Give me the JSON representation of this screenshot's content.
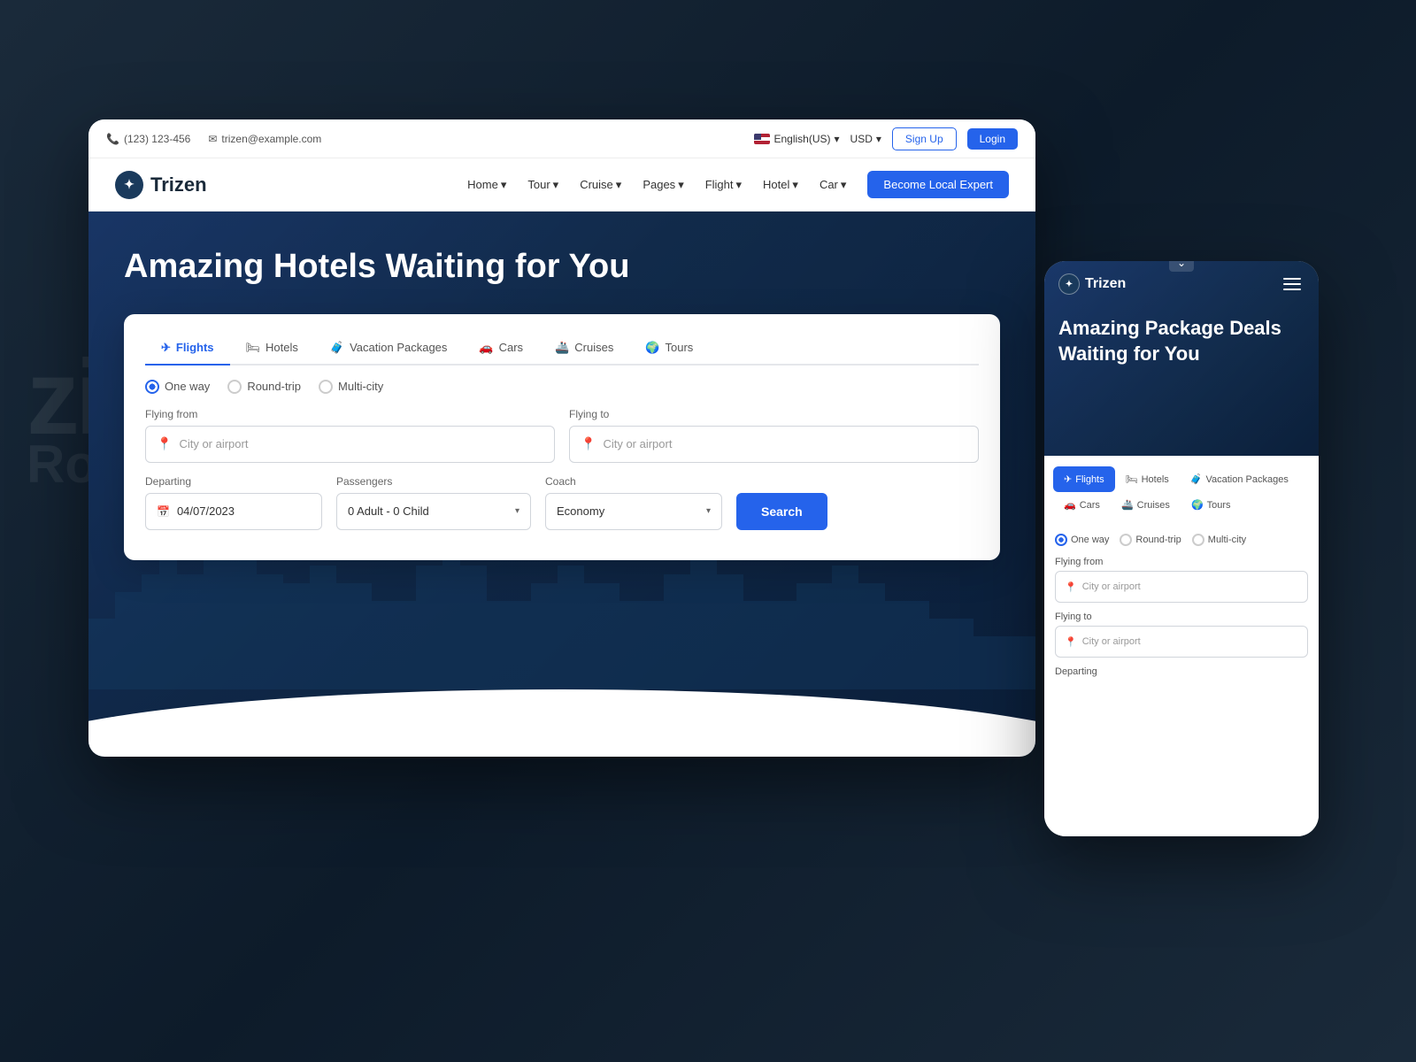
{
  "background": {
    "color": "#1a2a3a"
  },
  "topbar": {
    "phone": "(123) 123-456",
    "email": "trizen@example.com",
    "language": "English(US)",
    "currency": "USD",
    "signup_label": "Sign Up",
    "login_label": "Login"
  },
  "navbar": {
    "logo_text": "Trizen",
    "nav_items": [
      "Home",
      "Tour",
      "Cruise",
      "Pages",
      "Flight",
      "Hotel",
      "Car"
    ],
    "cta_label": "Become Local Expert"
  },
  "hero": {
    "title": "Amazing Hotels Waiting for You"
  },
  "search": {
    "tabs": [
      "Flights",
      "Hotels",
      "Vacation Packages",
      "Cars",
      "Cruises",
      "Tours"
    ],
    "trip_type_one_way": "One way",
    "trip_type_round": "Round-trip",
    "trip_type_multi": "Multi-city",
    "flying_from_label": "Flying from",
    "flying_from_placeholder": "City or airport",
    "flying_to_label": "Flying to",
    "flying_to_placeholder": "City or airport",
    "departing_label": "Departing",
    "departing_value": "04/07/2023",
    "passengers_label": "Passengers",
    "passengers_value": "0 Adult - 0 Child",
    "coach_label": "Coach",
    "coach_value": "Economy",
    "search_button_label": "Search"
  },
  "mobile": {
    "logo_text": "Trizen",
    "hero_title": "Amazing Package Deals Waiting for You",
    "tabs": [
      "Flights",
      "Hotels",
      "Vacation Packages",
      "Cars",
      "Cruises",
      "Tours"
    ],
    "trip_type_one_way": "One way",
    "trip_type_round": "Round-trip",
    "trip_type_multi": "Multi-city",
    "flying_from_label": "Flying from",
    "flying_from_placeholder": "City or airport",
    "flying_to_label": "Flying to",
    "flying_to_placeholder": "City or airport",
    "departing_label": "Departing"
  }
}
